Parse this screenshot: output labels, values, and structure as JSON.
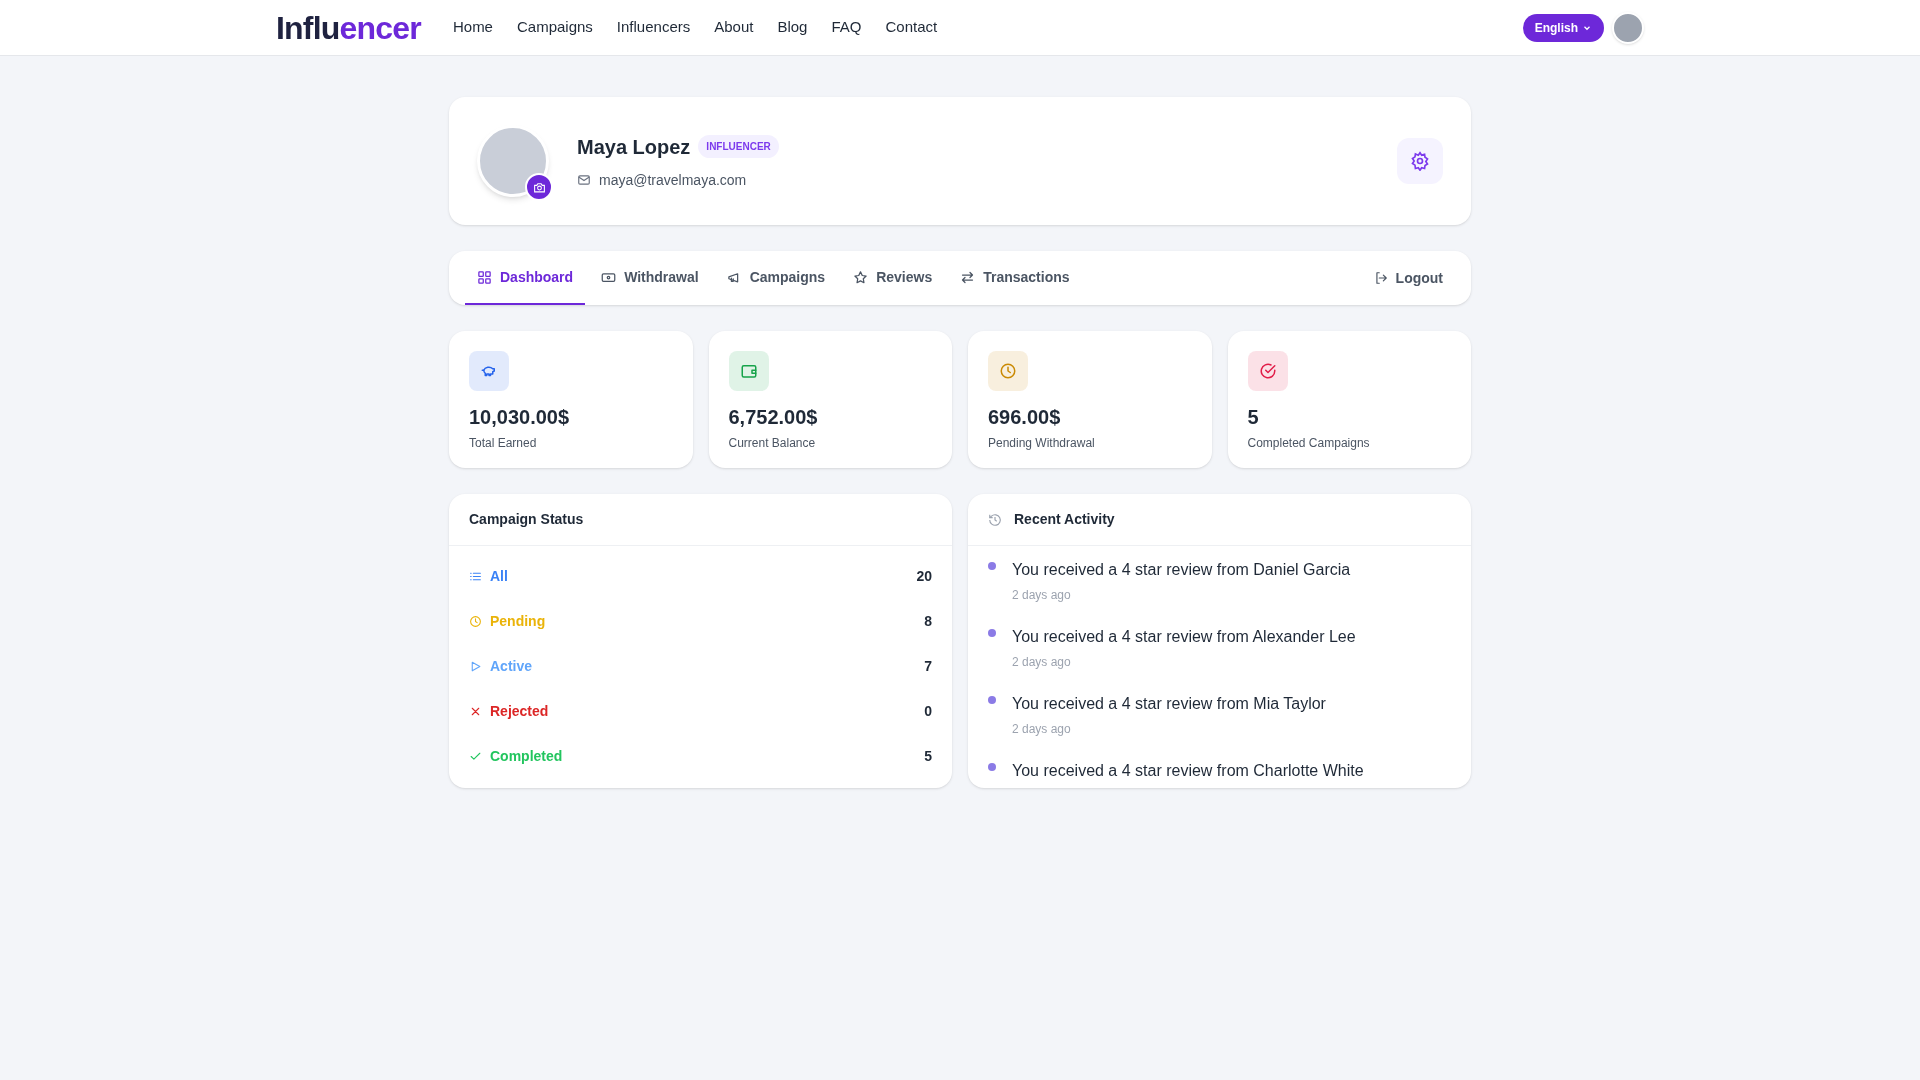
{
  "header": {
    "logo": {
      "text": "Influ",
      "accent": "encer"
    },
    "nav": [
      {
        "label": "Home"
      },
      {
        "label": "Campaigns"
      },
      {
        "label": "Influencers"
      },
      {
        "label": "About"
      },
      {
        "label": "Blog"
      },
      {
        "label": "FAQ"
      },
      {
        "label": "Contact"
      }
    ],
    "language": "English"
  },
  "profile": {
    "name": "Maya Lopez",
    "role": "INFLUENCER",
    "email": "maya@travelmaya.com"
  },
  "tabs": [
    {
      "label": "Dashboard",
      "kind": "grid",
      "selected": true
    },
    {
      "label": "Withdrawal",
      "kind": "cash",
      "selected": false
    },
    {
      "label": "Campaigns",
      "kind": "megaphone",
      "selected": false
    },
    {
      "label": "Reviews",
      "kind": "star",
      "selected": false
    },
    {
      "label": "Transactions",
      "kind": "arrows",
      "selected": false
    }
  ],
  "logout": "Logout",
  "stats": [
    {
      "value": "10,030.00$",
      "label": "Total Earned",
      "kind": "piggy",
      "color": "#2563eb"
    },
    {
      "value": "6,752.00$",
      "label": "Current Balance",
      "kind": "wallet",
      "color": "#16a34a"
    },
    {
      "value": "696.00$",
      "label": "Pending Withdrawal",
      "kind": "clock",
      "color": "#ca8a04"
    },
    {
      "value": "5",
      "label": "Completed Campaigns",
      "kind": "check-circle",
      "color": "#e11d48"
    }
  ],
  "campaign_status": {
    "title": "Campaign Status",
    "items": [
      {
        "label": "All",
        "count": "20",
        "kind": "list",
        "color": "#3b82f6"
      },
      {
        "label": "Pending",
        "count": "8",
        "kind": "clock",
        "color": "#eab308"
      },
      {
        "label": "Active",
        "count": "7",
        "kind": "play",
        "color": "#60a5fa"
      },
      {
        "label": "Rejected",
        "count": "0",
        "kind": "x",
        "color": "#dc2626"
      },
      {
        "label": "Completed",
        "count": "5",
        "kind": "check",
        "color": "#22c55e"
      }
    ]
  },
  "recent_activity": {
    "title": "Recent Activity",
    "items": [
      {
        "text": "You received a 4 star review from Daniel Garcia",
        "time": "2 days ago"
      },
      {
        "text": "You received a 4 star review from Alexander Lee",
        "time": "2 days ago"
      },
      {
        "text": "You received a 4 star review from Mia Taylor",
        "time": "2 days ago"
      },
      {
        "text": "You received a 4 star review from Charlotte White"
      }
    ]
  }
}
